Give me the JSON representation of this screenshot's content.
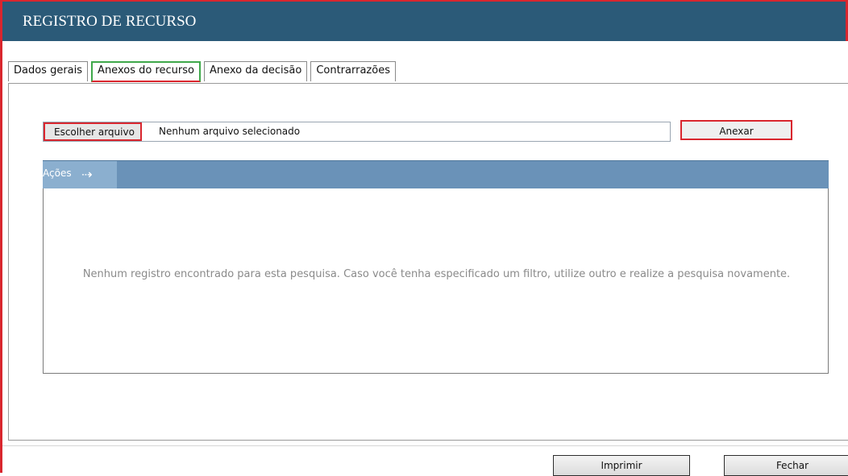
{
  "window": {
    "title": "REGISTRO DE RECURSO"
  },
  "tabs": [
    {
      "label": "Dados gerais"
    },
    {
      "label": "Anexos do recurso"
    },
    {
      "label": "Anexo da decisão"
    },
    {
      "label": "Contrarrazões"
    }
  ],
  "active_tab": "Anexos do recurso",
  "upload": {
    "choose_label": "Escolher arquivo",
    "status": "Nenhum arquivo selecionado",
    "attach_label": "Anexar"
  },
  "grid": {
    "actions_label": "Ações",
    "arrow_icon": "arrow-right-icon",
    "empty_message": "Nenhum registro encontrado para esta pesquisa. Caso você tenha especificado um filtro, utilize outro e realize a pesquisa novamente."
  },
  "footer": {
    "print_label": "Imprimir",
    "close_label": "Fechar"
  },
  "colors": {
    "titlebar": "#2b5a78",
    "highlight": "#d9262e",
    "grid_header": "#6a92b8"
  }
}
